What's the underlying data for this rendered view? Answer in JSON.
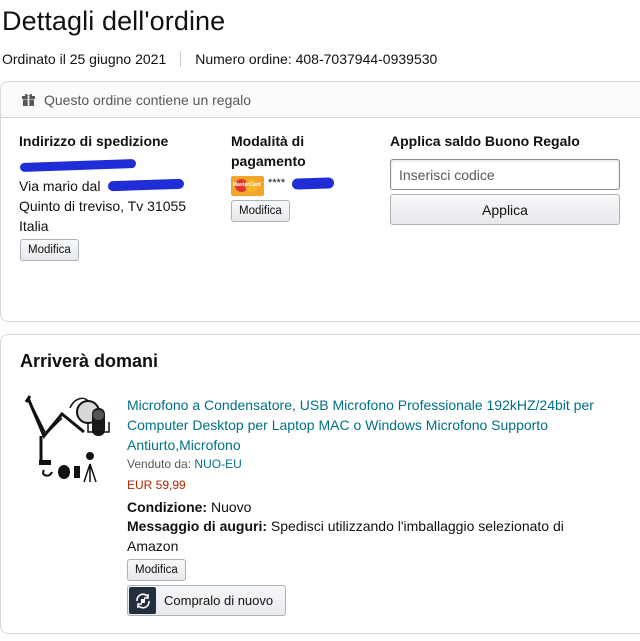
{
  "page": {
    "title": "Dettagli dell'ordine",
    "ordered_on": "Ordinato il 25 giugno 2021",
    "order_number": "Numero ordine: 408-7037944-0939530"
  },
  "gift_banner": {
    "icon": "gift-icon",
    "text": "Questo ordine contiene un regalo"
  },
  "shipping": {
    "heading": "Indirizzo di spedizione",
    "lines": [
      "Via mario dal",
      "Quinto di treviso, Tv 31055",
      "Italia"
    ],
    "edit_label": "Modifica"
  },
  "payment": {
    "heading": "Modalità di pagamento",
    "card_icon": "mastercard-icon",
    "card_mask": "****",
    "edit_label": "Modifica"
  },
  "gift_balance": {
    "heading": "Applica saldo Buono Regalo",
    "input_placeholder": "Inserisci codice",
    "apply_label": "Applica"
  },
  "shipment": {
    "heading": "Arriverà domani",
    "product": {
      "title": "Microfono a Condensatore, USB Microfono Professionale 192kHZ/24bit per Computer Desktop per Laptop MAC o Windows Microfono Supporto Antiurto,Microfono",
      "sold_by_label": "Venduto da:",
      "seller": "NUO-EU",
      "price": "EUR 59,99",
      "condition_label": "Condizione:",
      "condition_value": "Nuovo",
      "gift_message_label": "Messaggio di auguri:",
      "gift_message_value": "Spedisci utilizzando l'imballaggio selezionato di Amazon",
      "edit_label": "Modifica",
      "buy_again_label": "Compralo di nuovo",
      "buy_again_icon": "buy-again-icon"
    }
  },
  "colors": {
    "link": "#007185",
    "price": "#b12704",
    "redaction": "#1f2dd6",
    "border": "#d5d9d9"
  }
}
